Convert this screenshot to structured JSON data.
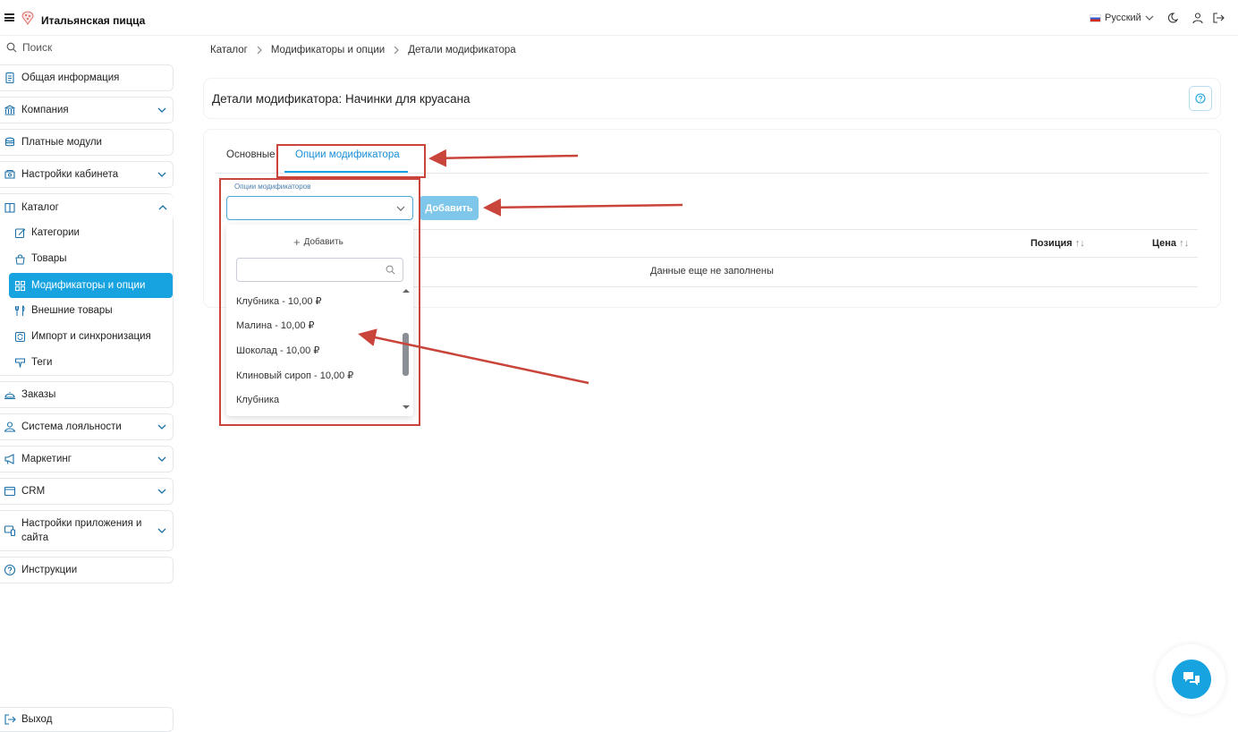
{
  "app": {
    "title": "Итальянская пицца"
  },
  "header": {
    "language": "Русский"
  },
  "sidebar": {
    "search_placeholder": "Поиск",
    "items": [
      {
        "label": "Общая информация"
      },
      {
        "label": "Компания"
      },
      {
        "label": "Платные модули"
      },
      {
        "label": "Настройки кабинета"
      },
      {
        "label": "Каталог"
      },
      {
        "label": "Заказы"
      },
      {
        "label": "Система лояльности"
      },
      {
        "label": "Маркетинг"
      },
      {
        "label": "CRM"
      },
      {
        "label": "Настройки приложения и сайта"
      },
      {
        "label": "Инструкции"
      }
    ],
    "catalog_sub": [
      {
        "label": "Категории"
      },
      {
        "label": "Товары"
      },
      {
        "label": "Модификаторы и опции"
      },
      {
        "label": "Внешние товары"
      },
      {
        "label": "Импорт и синхронизация"
      },
      {
        "label": "Теги"
      }
    ],
    "logout": "Выход"
  },
  "breadcrumb": [
    "Каталог",
    "Модификаторы и опции",
    "Детали модификатора"
  ],
  "page": {
    "title": "Детали модификатора: Начинки для круасана",
    "tabs": [
      "Основные",
      "Опции модификатора"
    ],
    "field_label": "Опции модификаторов",
    "add_button": "Добавить",
    "table": {
      "columns": [
        "Позиция",
        "Цена"
      ],
      "empty": "Данные еще не заполнены"
    }
  },
  "dropdown": {
    "add_label": "Добавить",
    "options": [
      "Клубника - 10,00 ₽",
      "Малина - 10,00 ₽",
      "Шоколад - 10,00 ₽",
      "Клиновый сироп - 10,00 ₽",
      "Клубника"
    ]
  },
  "colors": {
    "accent": "#17a2e0",
    "annotation": "#c9443a"
  }
}
